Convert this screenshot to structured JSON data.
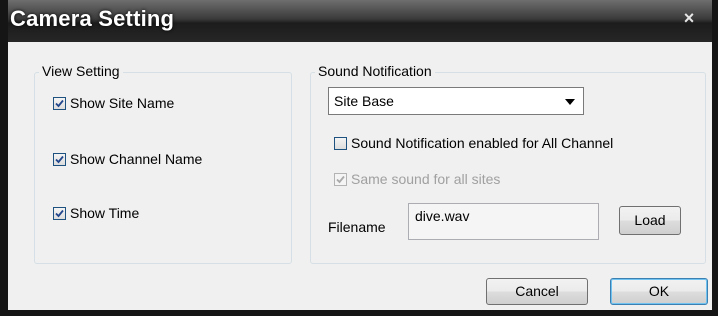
{
  "window": {
    "title": "Camera Setting",
    "close_symbol": "×"
  },
  "view_setting": {
    "legend": "View Setting",
    "items": [
      {
        "label": "Show Site Name",
        "checked": true
      },
      {
        "label": "Show Channel Name",
        "checked": true
      },
      {
        "label": "Show Time",
        "checked": true
      }
    ]
  },
  "sound_notification": {
    "legend": "Sound Notification",
    "mode_select": {
      "value": "Site Base"
    },
    "all_channel": {
      "label": "Sound Notification enabled for All Channel",
      "checked": false
    },
    "same_sound": {
      "label": "Same sound for all sites",
      "checked": true,
      "disabled": true
    },
    "filename_label": "Filename",
    "filename_value": "dive.wav",
    "load_label": "Load"
  },
  "footer": {
    "cancel_label": "Cancel",
    "ok_label": "OK"
  }
}
